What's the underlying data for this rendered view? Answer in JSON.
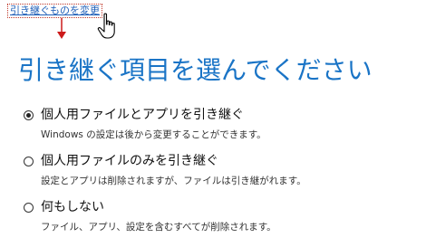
{
  "top_link": {
    "label": "引き継ぐものを変更"
  },
  "page_title": "引き継ぐ項目を選んでください",
  "options": [
    {
      "label": "個人用ファイルとアプリを引き継ぐ",
      "description": "Windows の設定は後から変更することができます。",
      "selected": true
    },
    {
      "label": "個人用ファイルのみを引き継ぐ",
      "description": "設定とアプリは削除されますが、ファイルは引き継がれます。",
      "selected": false
    },
    {
      "label": "何もしない",
      "description": "ファイル、アプリ、設定を含むすべてが削除されます。",
      "selected": false
    }
  ],
  "icons": {
    "cursor": "hand-pointer-icon",
    "arrow": "red-down-arrow-icon"
  },
  "colors": {
    "heading": "#1a74c6",
    "link": "#1f5fb8",
    "arrow": "#cc1a1a"
  }
}
